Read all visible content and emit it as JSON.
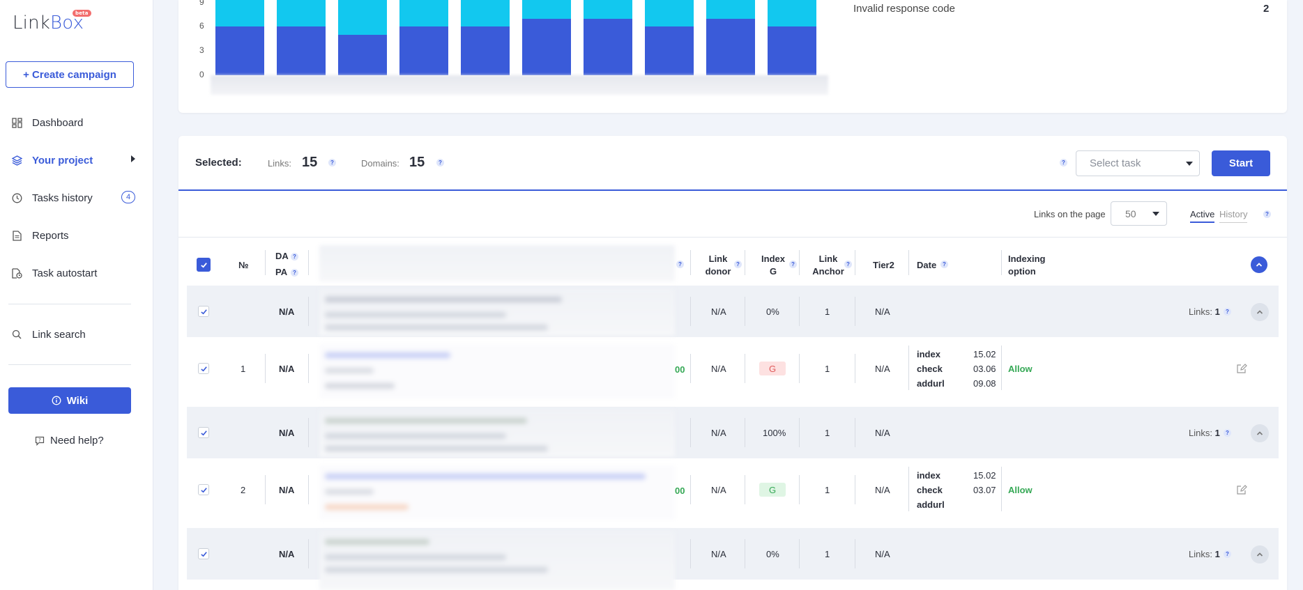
{
  "sidebar": {
    "logo_text_1": "Link",
    "logo_text_2": "Box",
    "beta": "beta",
    "create_campaign": "+ Create campaign",
    "items": [
      {
        "label": "Dashboard",
        "icon": "dashboard-icon"
      },
      {
        "label": "Your project",
        "icon": "layers-icon",
        "active": true
      },
      {
        "label": "Tasks history",
        "icon": "clock-icon",
        "count": "4"
      },
      {
        "label": "Reports",
        "icon": "document-icon"
      },
      {
        "label": "Task autostart",
        "icon": "autostart-icon"
      },
      {
        "label": "Link search",
        "icon": "search-icon"
      }
    ],
    "wiki": "Wiki",
    "help": "Need help?"
  },
  "chart_data": {
    "type": "bar",
    "stacked": true,
    "y_ticks": [
      "9",
      "6",
      "3",
      "0"
    ],
    "ylim": [
      0,
      10
    ],
    "categories": [
      "",
      "",
      "",
      "",
      "",
      "",
      "",
      "",
      "",
      ""
    ],
    "series": [
      {
        "color": "#3a5bd9",
        "values": [
          6,
          6,
          5,
          6,
          6,
          7,
          7,
          6,
          7,
          6
        ]
      },
      {
        "color": "#12c8ef",
        "values": [
          4,
          4,
          5,
          4,
          4,
          3,
          3,
          4,
          3,
          4
        ]
      }
    ]
  },
  "stats": {
    "invalid_label": "Invalid response code",
    "invalid_value": "2"
  },
  "selection": {
    "selected_label": "Selected:",
    "links_label": "Links:",
    "links_value": "15",
    "domains_label": "Domains:",
    "domains_value": "15",
    "task_placeholder": "Select task",
    "start": "Start"
  },
  "pagination": {
    "links_on_page_label": "Links on the page",
    "per_page": "50",
    "tab_active": "Active",
    "tab_history": "History"
  },
  "table": {
    "headers": {
      "num": "№",
      "da": "DA",
      "pa": "PA",
      "link_donor_1": "Link",
      "link_donor_2": "donor",
      "index_g_1": "Index",
      "index_g_2": "G",
      "link_anchor_1": "Link",
      "link_anchor_2": "Anchor",
      "tier2": "Tier2",
      "date": "Date",
      "indexing_1": "Indexing",
      "indexing_2": "option"
    },
    "groups": [
      {
        "da": "N/A",
        "donor": "N/A",
        "index": "0%",
        "anchor": "1",
        "tier2": "N/A",
        "links_label": "Links:",
        "links": "1"
      },
      {
        "da": "N/A",
        "donor": "N/A",
        "index": "100%",
        "anchor": "1",
        "tier2": "N/A",
        "links_label": "Links:",
        "links": "1"
      },
      {
        "da": "N/A",
        "donor": "N/A",
        "index": "0%",
        "anchor": "1",
        "tier2": "N/A",
        "links_label": "Links:",
        "links": "1"
      }
    ],
    "rows": [
      {
        "num": "1",
        "da": "N/A",
        "status": "00",
        "donor": "N/A",
        "g": "G",
        "anchor": "1",
        "tier2": "N/A",
        "dates": [
          {
            "k": "index",
            "v": "15.02"
          },
          {
            "k": "check",
            "v": "03.06"
          },
          {
            "k": "addurl",
            "v": "09.08"
          }
        ],
        "indexing": "Allow"
      },
      {
        "num": "2",
        "da": "N/A",
        "status": "00",
        "donor": "N/A",
        "g": "G",
        "anchor": "1",
        "tier2": "N/A",
        "dates": [
          {
            "k": "index",
            "v": "15.02"
          },
          {
            "k": "check",
            "v": "03.07"
          },
          {
            "k": "addurl",
            "v": ""
          }
        ],
        "indexing": "Allow"
      }
    ]
  }
}
